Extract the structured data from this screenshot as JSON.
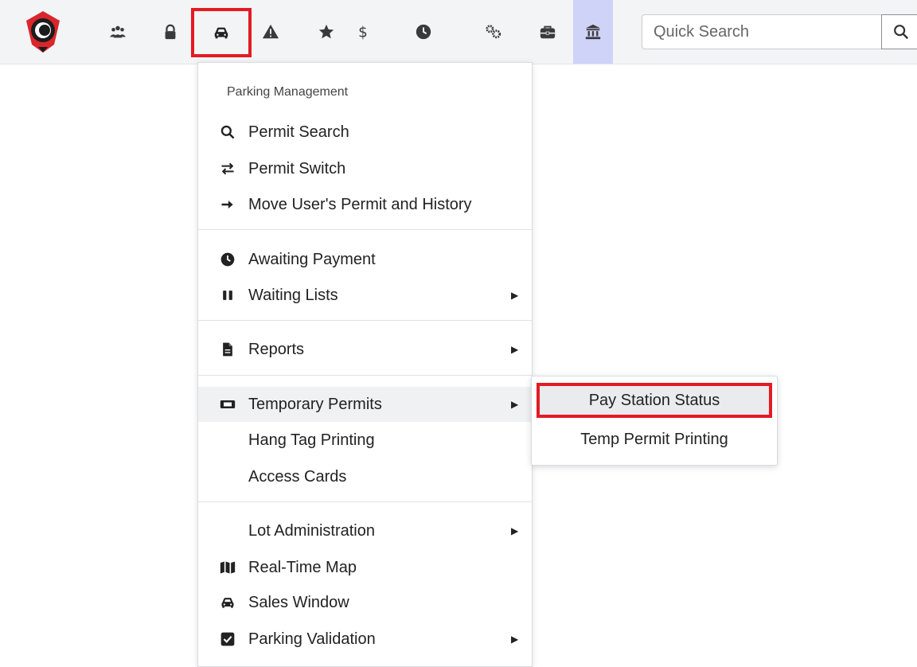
{
  "toolbar": {
    "icons": [
      "logo",
      "users-icon",
      "lock-icon",
      "car-icon",
      "warning-icon",
      "star-icon",
      "dollar-icon",
      "clock-icon",
      "gears-icon",
      "toolbox-icon",
      "building-icon"
    ],
    "active_icon": "car-icon",
    "highlight_icon": "building-icon",
    "active_color": "#e31b23",
    "highlight_color": "#cfd3f7"
  },
  "search": {
    "placeholder": "Quick Search",
    "value": ""
  },
  "menu": {
    "header": "Parking Management",
    "items": [
      {
        "label": "Permit Search",
        "icon": "search-icon"
      },
      {
        "label": "Permit Switch",
        "icon": "exchange-icon"
      },
      {
        "label": "Move User's Permit and History",
        "icon": "arrow-right-icon"
      },
      {
        "label": "Awaiting Payment",
        "icon": "clock-icon"
      },
      {
        "label": "Waiting Lists",
        "icon": "pause-icon",
        "submenu": true
      },
      {
        "label": "Reports",
        "icon": "file-icon",
        "submenu": true
      },
      {
        "label": "Temporary Permits",
        "icon": "ticket-icon",
        "submenu": true,
        "open": true
      },
      {
        "label": "Hang Tag Printing",
        "icon": ""
      },
      {
        "label": "Access Cards",
        "icon": ""
      },
      {
        "label": "Lot Administration",
        "icon": "",
        "submenu": true
      },
      {
        "label": "Real-Time Map",
        "icon": "map-icon"
      },
      {
        "label": "Sales Window",
        "icon": "car-icon"
      },
      {
        "label": "Parking Validation",
        "icon": "check-square-icon",
        "submenu": true
      }
    ]
  },
  "submenu": {
    "items": [
      {
        "label": "Pay Station Status",
        "selected": true
      },
      {
        "label": "Temp Permit Printing",
        "selected": false
      }
    ]
  }
}
